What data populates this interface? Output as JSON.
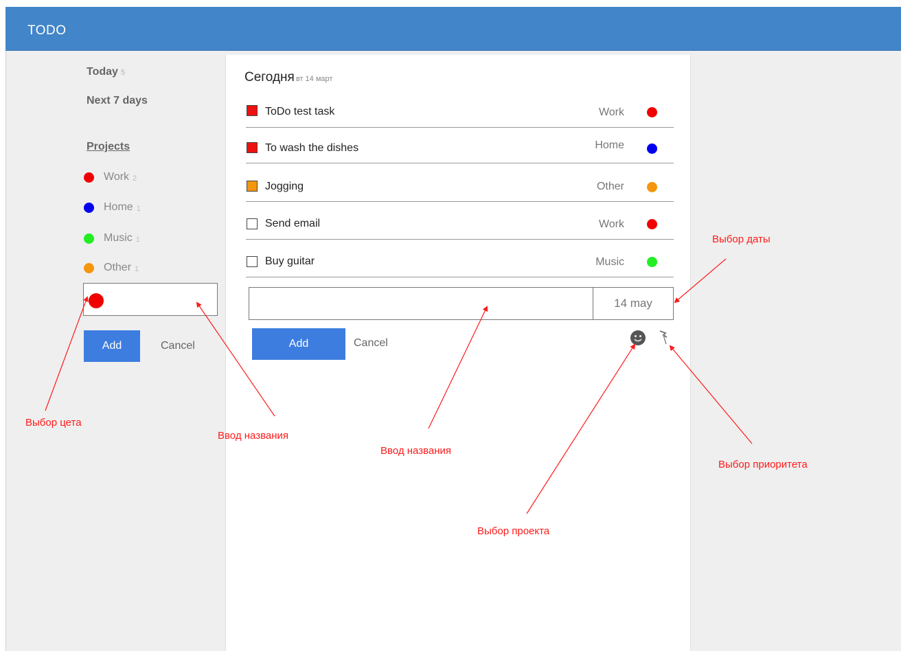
{
  "header": {
    "title": "TODO"
  },
  "sidebar": {
    "today": {
      "label": "Today",
      "count": "5"
    },
    "next7": {
      "label": "Next 7 days"
    },
    "projects_heading": "Projects",
    "projects": [
      {
        "name": "Work",
        "count": "2",
        "color": "#f00000"
      },
      {
        "name": "Home",
        "count": "1",
        "color": "#0000ee"
      },
      {
        "name": "Music",
        "count": "1",
        "color": "#22ee22"
      },
      {
        "name": "Other",
        "count": "1",
        "color": "#f5960f"
      }
    ],
    "new_project": {
      "color": "#f00000",
      "value": ""
    },
    "add_label": "Add",
    "cancel_label": "Cancel"
  },
  "main": {
    "title": "Сегодня",
    "date": "вт 14 март",
    "tasks": [
      {
        "text": "ToDo test task",
        "project": "Work",
        "priority_color": "#ee1111",
        "project_color": "#f00000"
      },
      {
        "text": "To wash the dishes",
        "project": "Home",
        "priority_color": "#ee1111",
        "project_color": "#0000ee"
      },
      {
        "text": "Jogging",
        "project": "Other",
        "priority_color": "#f5960f",
        "project_color": "#f5960f"
      },
      {
        "text": "Send email",
        "project": "Work",
        "priority_color": "none",
        "project_color": "#f00000"
      },
      {
        "text": "Buy guitar",
        "project": "Music",
        "priority_color": "none",
        "project_color": "#22ee22"
      }
    ],
    "new_task": {
      "value": "",
      "date": "14 may"
    },
    "add_label": "Add",
    "cancel_label": "Cancel",
    "icons": {
      "project": "smiley-icon",
      "priority": "flag-icon"
    }
  },
  "annotations": {
    "color_choice": "Выбор цета",
    "name_input_left": "Ввод названия",
    "name_input_main": "Ввод названия",
    "project_choice": "Выбор проекта",
    "date_choice": "Выбор даты",
    "priority_choice": "Выбор приоритета",
    "color": "#ff1a1a"
  }
}
